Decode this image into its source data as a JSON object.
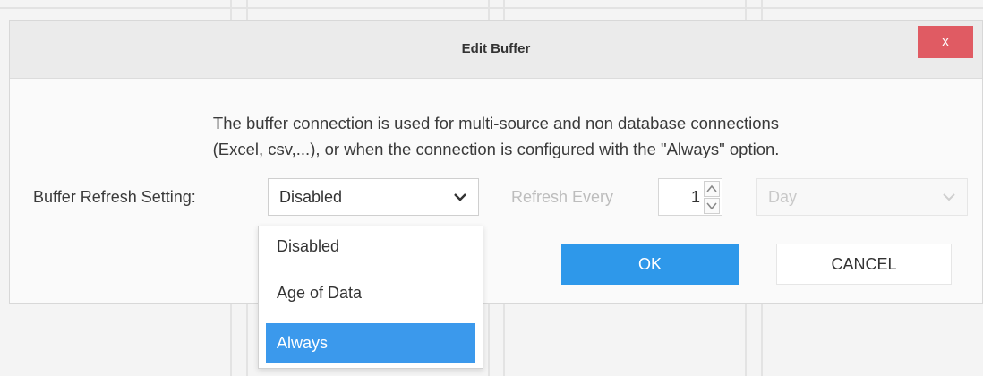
{
  "dialog": {
    "title": "Edit Buffer",
    "close_label": "x",
    "description_line1": "The buffer connection is used for multi-source and non database connections",
    "description_line2": "(Excel, csv,...), or when the connection is configured with the \"Always\" option."
  },
  "refresh_setting": {
    "label": "Buffer Refresh Setting:",
    "selected": "Disabled",
    "options": [
      "Disabled",
      "Age of Data",
      "Always"
    ],
    "highlighted": "Always"
  },
  "refresh_every": {
    "label": "Refresh Every",
    "value": "1",
    "unit": "Day"
  },
  "buttons": {
    "ok": "OK",
    "cancel": "CANCEL"
  },
  "colors": {
    "close": "#e05b63",
    "primary": "#2e98ea",
    "highlight": "#3b99ec"
  }
}
